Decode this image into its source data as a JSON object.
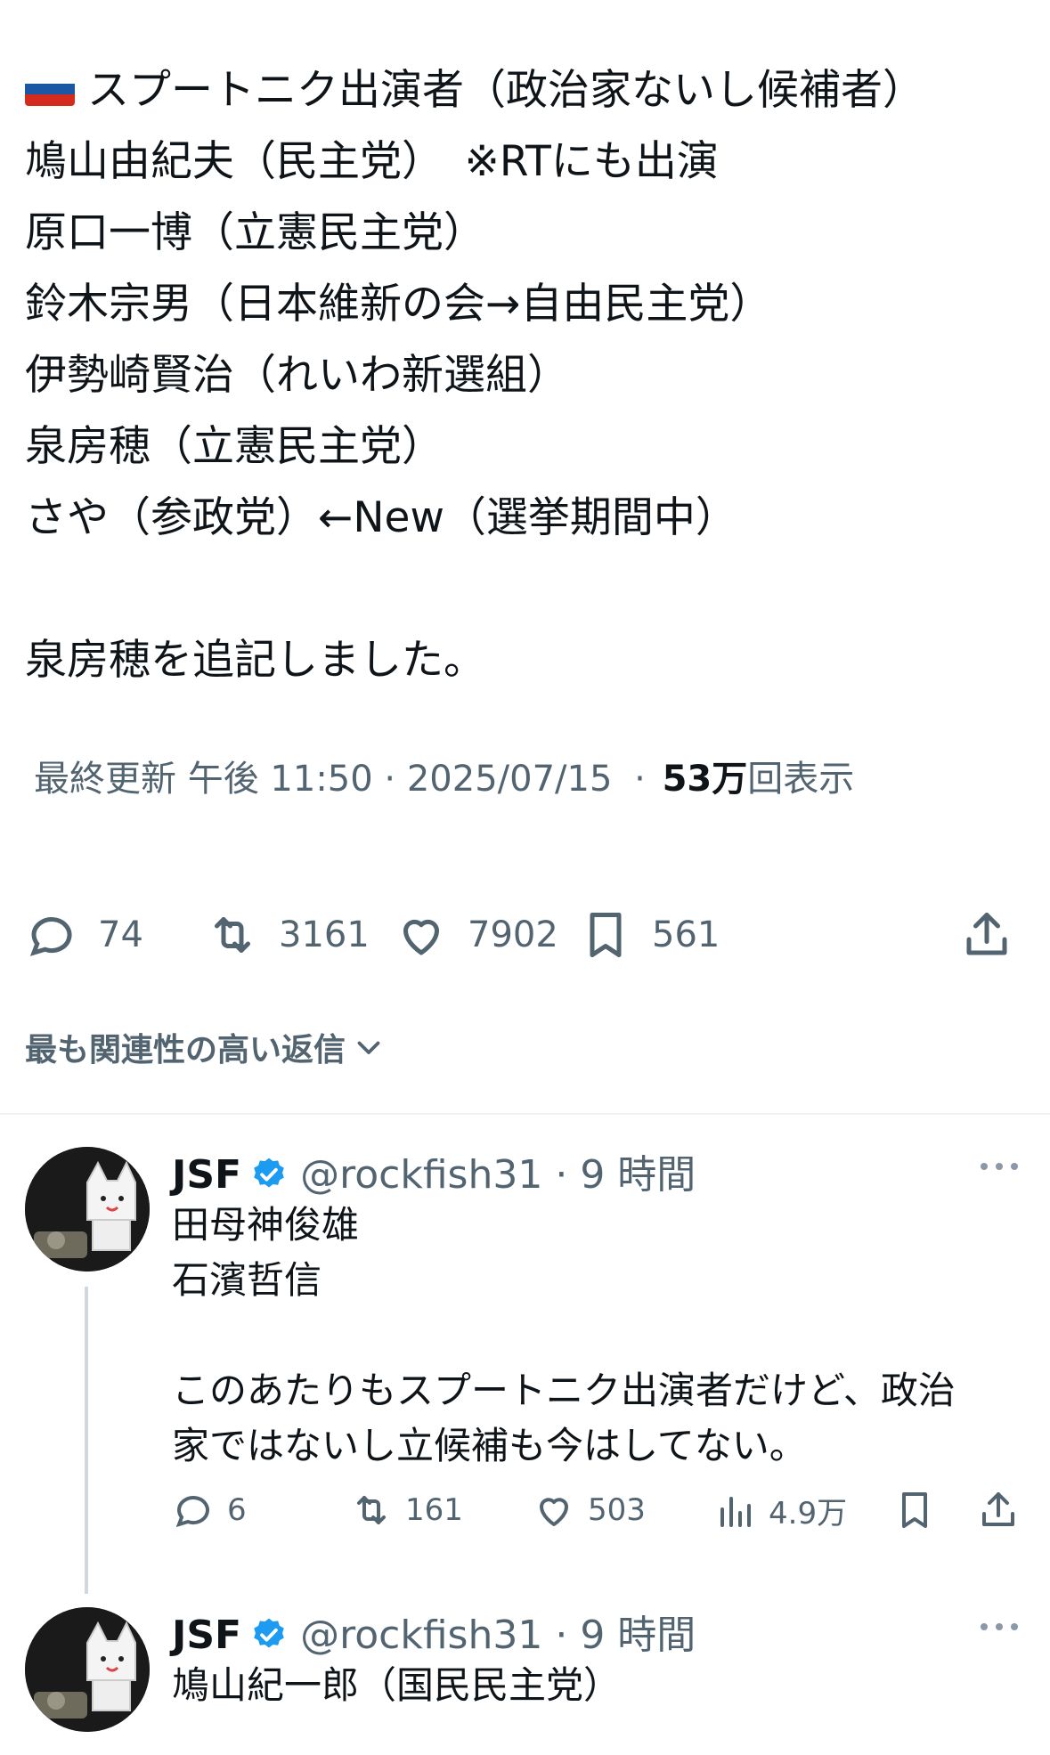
{
  "post": {
    "flag_icon": "russia-flag-icon",
    "lines": [
      "スプートニク出演者（政治家ないし候補者）",
      "鳩山由紀夫（民主党）　※RTにも出演",
      "原口一博（立憲民主党）",
      "鈴木宗男（日本維新の会→自由民主党）",
      "伊勢崎賢治（れいわ新選組）",
      "泉房穂（立憲民主党）",
      "さや（参政党）←New（選挙期間中）",
      "泉房穂を追記しました。"
    ],
    "updated_label": "最終更新 午後 11:50 · 2025/07/15",
    "views_sep": "·",
    "views_count": "53万",
    "views_label": "回表示"
  },
  "actions": {
    "replies": "74",
    "reposts": "3161",
    "likes": "7902",
    "bookmarks": "561"
  },
  "sort": {
    "label": "最も関連性の高い返信"
  },
  "replies": [
    {
      "name": "JSF",
      "handle": "@rockfish31 · 9 時間",
      "text_lines": [
        "田母神俊雄",
        "石濱哲信",
        "",
        "このあたりもスプートニク出演者だけど、政治",
        "家ではないし立候補も今はしてない。"
      ],
      "replies": "6",
      "reposts": "161",
      "likes": "503",
      "views": "4.9万"
    },
    {
      "name": "JSF",
      "handle": "@rockfish31 · 9 時間",
      "text_lines": [
        "鳩山紀一郎（国民民主党）"
      ]
    }
  ],
  "colors": {
    "text": "#0f1419",
    "secondary": "#536471",
    "verified": "#1d9bf0",
    "divider": "#eff3f4"
  }
}
